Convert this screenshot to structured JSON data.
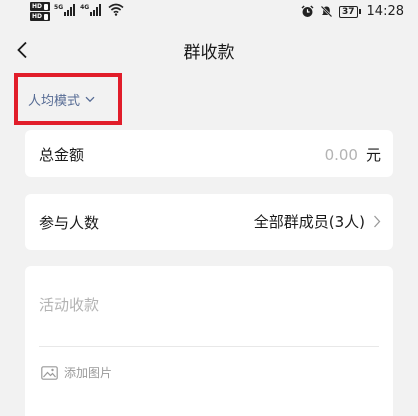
{
  "status_bar": {
    "hd_badge_1": "HD",
    "hd_badge_2": "HD",
    "network_1": "5G",
    "network_2": "4G",
    "battery": "37",
    "time": "14:28"
  },
  "nav": {
    "title": "群收款",
    "back_icon": "chevron-left-icon"
  },
  "mode": {
    "label": "人均模式",
    "highlight_color": "#e11d2a"
  },
  "total": {
    "label": "总金额",
    "value": "0.00",
    "unit": "元"
  },
  "members": {
    "label": "参与人数",
    "value": "全部群成员(3人)"
  },
  "activity": {
    "placeholder": "活动收款",
    "add_image_label": "添加图片"
  },
  "colors": {
    "background": "#f2f2f2",
    "card": "#ffffff",
    "accent_text": "#566b94",
    "placeholder": "#b3b3b3"
  }
}
